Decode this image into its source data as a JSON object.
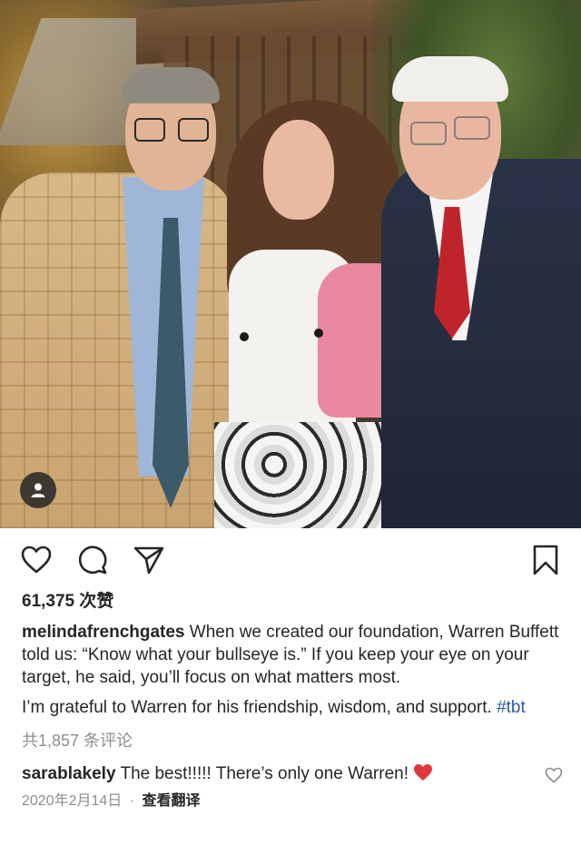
{
  "post": {
    "likes_text": "61,375 次赞",
    "caption_user": "melindafrenchgates",
    "caption_p1": "When we created our foundation, Warren Buffett told us: “Know what your bullseye is.” If you keep your eye on your target, he said, you’ll focus on what matters most.",
    "caption_p2": "I’m grateful to Warren for his friendship, wisdom, and support.",
    "hashtag": "#tbt",
    "comments_count_text": "共1,857 条评论",
    "top_comment": {
      "user": "sarablakely",
      "text": "The best!!!!! There’s only one Warren!"
    },
    "date_text": "2020年2月14日",
    "separator": "·",
    "translate_label": "查看翻译"
  },
  "icons": {
    "like": "heart-outline-icon",
    "comment": "comment-bubble-icon",
    "share": "paper-plane-icon",
    "save": "bookmark-icon",
    "tagged": "person-tag-icon",
    "emoji": "red-heart-emoji",
    "comment_like": "small-heart-icon"
  },
  "colors": {
    "text": "#262626",
    "muted": "#8e8e8e",
    "link": "#2b5aa8",
    "heart_red": "#e0383e"
  }
}
